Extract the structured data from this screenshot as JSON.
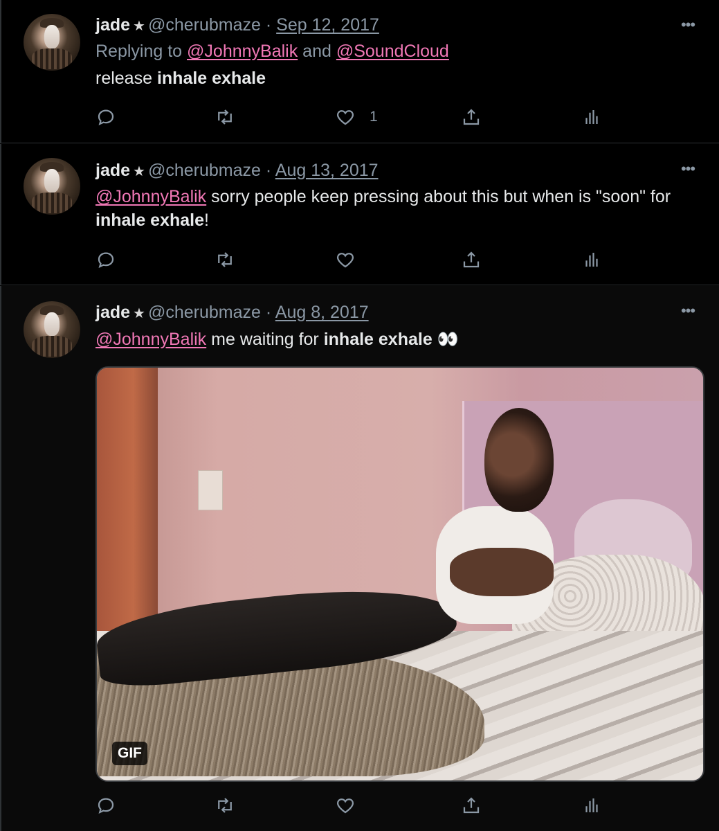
{
  "colors": {
    "background": "#000000",
    "text": "#e7e9ea",
    "muted": "#8b98a5",
    "mention": "#f178b6",
    "divider": "#2f3336"
  },
  "tweets": [
    {
      "name": "jade",
      "star": "★",
      "handle": "@cherubmaze",
      "separator": "·",
      "date": "Sep 12, 2017",
      "replying": {
        "prefix": "Replying to",
        "mention1": "@JohnnyBalik",
        "conjunction": "and",
        "mention2": "@SoundCloud"
      },
      "text": {
        "plain": "release",
        "bold": "inhale exhale"
      },
      "like_count": "1",
      "icons": [
        "reply-icon",
        "retweet-icon",
        "heart-icon",
        "share-icon",
        "analytics-icon",
        "more-icon"
      ]
    },
    {
      "name": "jade",
      "star": "★",
      "handle": "@cherubmaze",
      "separator": "·",
      "date": "Aug 13, 2017",
      "text": {
        "mention": "@JohnnyBalik",
        "plain": "sorry people keep pressing about this but when is \"soon\" for",
        "bold": "inhale exhale",
        "end": "!"
      },
      "icons": [
        "reply-icon",
        "retweet-icon",
        "heart-icon",
        "share-icon",
        "analytics-icon",
        "more-icon"
      ]
    },
    {
      "name": "jade",
      "star": "★",
      "handle": "@cherubmaze",
      "separator": "·",
      "date": "Aug 8, 2017",
      "text": {
        "mention": "@JohnnyBalik",
        "plain": "me waiting for",
        "bold": "inhale exhale",
        "emoji": "👀"
      },
      "media": {
        "type": "gif",
        "badge": "GIF"
      },
      "icons": [
        "reply-icon",
        "retweet-icon",
        "heart-icon",
        "share-icon",
        "analytics-icon",
        "more-icon"
      ]
    }
  ]
}
